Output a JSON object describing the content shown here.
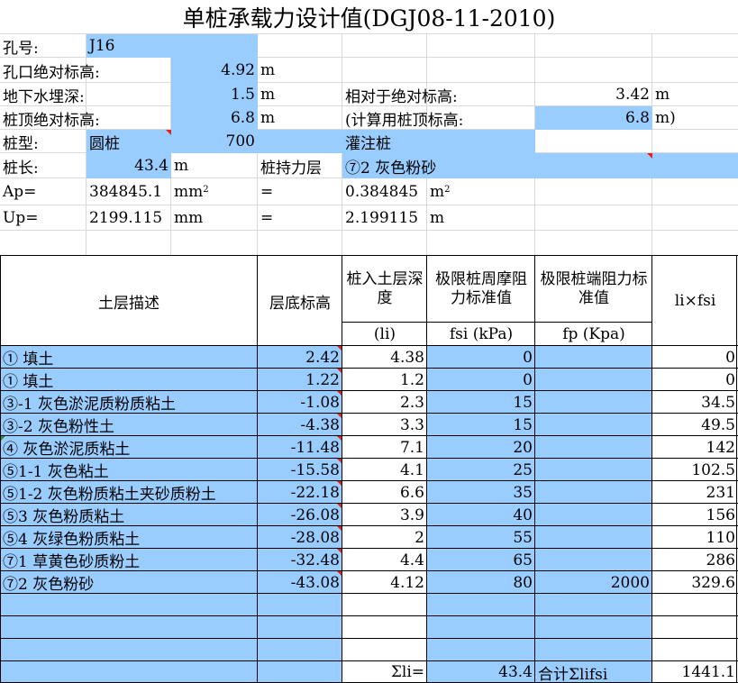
{
  "title": "单桩承载力设计值(DGJ08-11-2010)",
  "info": {
    "hole_label": "孔号:",
    "hole_value": "J16",
    "elev_label": "孔口绝对标高:",
    "elev_value": "4.92",
    "elev_unit": "m",
    "gw_label": "地下水埋深:",
    "gw_value": "1.5",
    "gw_unit": "m",
    "rel_label": "相对于绝对标高:",
    "rel_value": "3.42",
    "rel_unit": "m",
    "top_label": "桩顶绝对标高:",
    "top_value": "6.8",
    "top_unit": "m",
    "calc_label": "(计算用桩顶标高:",
    "calc_value": "6.8",
    "calc_unit": "m)",
    "type_label": "桩型:",
    "type_value": "圆桩",
    "type_dia": "700",
    "type_method": "灌注桩",
    "len_label": "桩长:",
    "len_value": "43.4",
    "len_unit": "m",
    "bearing_label": "桩持力层",
    "bearing_value": "⑦2 灰色粉砂",
    "ap_label": "Ap=",
    "ap_value": "384845.1",
    "ap_unit": "mm",
    "ap_eq": "=",
    "ap_value2": "0.384845",
    "ap_unit2": "m",
    "up_label": "Up=",
    "up_value": "2199.115",
    "up_unit": "mm",
    "up_eq": "=",
    "up_value2": "2.199115",
    "up_unit2": "m",
    "sup2": "2"
  },
  "table": {
    "headers": [
      "土层描述",
      "层底标高",
      "桩入土层深度",
      "极限桩周摩阻力标准值",
      "极限桩端阻力标准值",
      "li×fsi"
    ],
    "subheaders": [
      "",
      "",
      "(li)",
      "fsi (kPa)",
      "fp (Kpa)",
      ""
    ],
    "rows": [
      [
        "① 填土",
        "2.42",
        "4.38",
        "0",
        "",
        "0"
      ],
      [
        "① 填土",
        "1.22",
        "1.2",
        "0",
        "",
        "0"
      ],
      [
        "③-1 灰色淤泥质粉质粘土",
        "-1.08",
        "2.3",
        "15",
        "",
        "34.5"
      ],
      [
        "③-2 灰色粉性土",
        "-4.38",
        "3.3",
        "15",
        "",
        "49.5"
      ],
      [
        "④ 灰色淤泥质粘土",
        "-11.48",
        "7.1",
        "20",
        "",
        "142"
      ],
      [
        "⑤1-1 灰色粘土",
        "-15.58",
        "4.1",
        "25",
        "",
        "102.5"
      ],
      [
        "⑤1-2 灰色粉质粘土夹砂质粉土",
        "-22.18",
        "6.6",
        "35",
        "",
        "231"
      ],
      [
        "⑤3 灰色粉质粘土",
        "-26.08",
        "3.9",
        "40",
        "",
        "156"
      ],
      [
        "⑤4 灰绿色粉质粘土",
        "-28.08",
        "2",
        "55",
        "",
        "110"
      ],
      [
        "⑦1 草黄色砂质粉土",
        "-32.48",
        "4.4",
        "65",
        "",
        "286"
      ],
      [
        "⑦2 灰色粉砂",
        "-43.08",
        "4.12",
        "80",
        "2000",
        "329.6"
      ]
    ],
    "sum_li_label": "Σli=",
    "sum_li_value": "43.4",
    "total_label": "合计Σlifsi",
    "total_value": "1441.1"
  }
}
